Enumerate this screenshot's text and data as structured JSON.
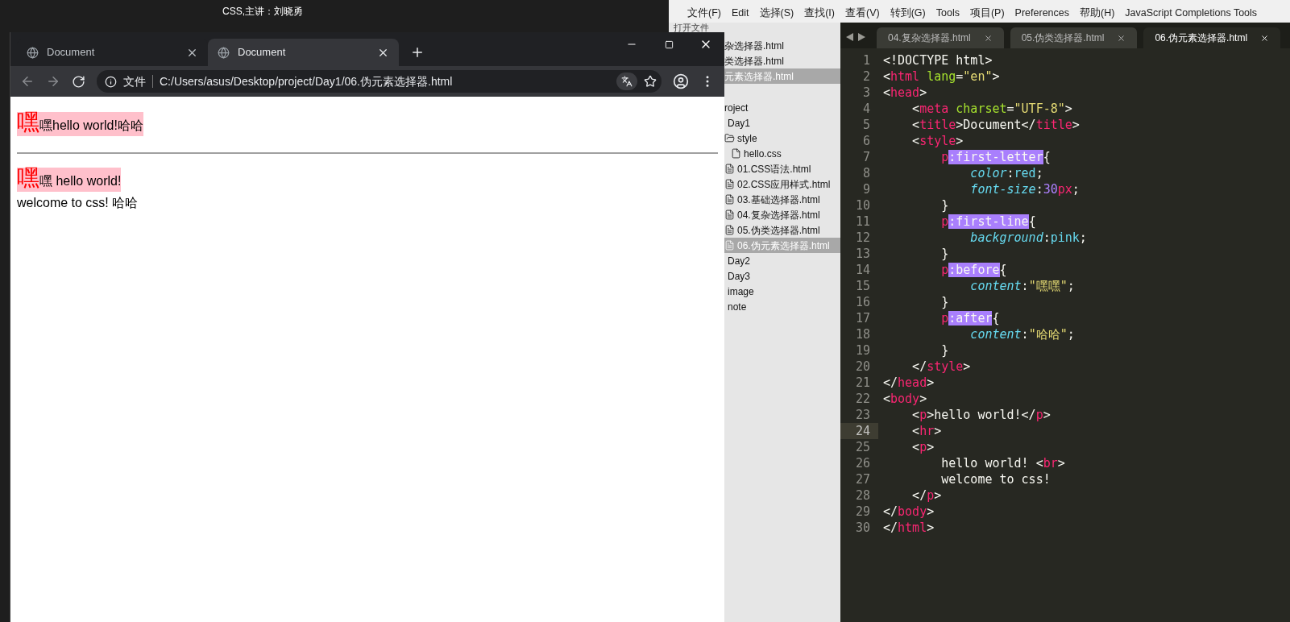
{
  "desktop": {
    "caption": "CSS,主讲：刘晓勇"
  },
  "browser": {
    "tabs": [
      {
        "title": "Document",
        "selected": false
      },
      {
        "title": "Document",
        "selected": true
      }
    ],
    "address": {
      "scheme_label": "文件",
      "url": "C:/Users/asus/Desktop/project/Day1/06.伪元素选择器.html"
    },
    "page": {
      "blocks": [
        {
          "kind": "paragraph",
          "first_letter": "嘿",
          "first_line": "嘿hello world!哈哈"
        },
        {
          "kind": "rule"
        },
        {
          "kind": "paragraph",
          "first_letter": "嘿",
          "first_line": "嘿 hello world!",
          "next_line": "welcome to css! 哈哈"
        }
      ]
    }
  },
  "editor": {
    "menu": [
      "文件(F)",
      "Edit",
      "选择(S)",
      "查找(I)",
      "查看(V)",
      "转到(G)",
      "Tools",
      "项目(P)",
      "Preferences",
      "帮助(H)",
      "JavaScript Completions Tools"
    ],
    "sidebar": {
      "header": "打开文件",
      "open_files": [
        {
          "name": "杂选择器.html",
          "selected": false
        },
        {
          "name": "类选择器.html",
          "selected": false
        },
        {
          "name": "元素选择器.html",
          "selected": true
        }
      ],
      "folders": [
        {
          "name": "roject",
          "kind": "folder",
          "selected": false,
          "children": [
            {
              "name": "Day1",
              "kind": "folder",
              "selected": false,
              "children": [
                {
                  "name": "style",
                  "kind": "open_folder",
                  "selected": false,
                  "children": [
                    {
                      "name": "hello.css",
                      "kind": "plain_file",
                      "selected": false
                    }
                  ]
                },
                {
                  "name": "01.CSS语法.html",
                  "kind": "file",
                  "selected": false
                },
                {
                  "name": "02.CSS应用样式.html",
                  "kind": "file",
                  "selected": false
                },
                {
                  "name": "03.基础选择器.html",
                  "kind": "file",
                  "selected": false
                },
                {
                  "name": "04.复杂选择器.html",
                  "kind": "file",
                  "selected": false
                },
                {
                  "name": "05.伪类选择器.html",
                  "kind": "file",
                  "selected": false
                },
                {
                  "name": "06.伪元素选择器.html",
                  "kind": "file",
                  "selected": true
                }
              ]
            },
            {
              "name": "Day2",
              "kind": "folder",
              "selected": false
            },
            {
              "name": "Day3",
              "kind": "folder",
              "selected": false
            },
            {
              "name": "image",
              "kind": "folder",
              "selected": false
            },
            {
              "name": "note",
              "kind": "folder",
              "selected": false
            }
          ]
        }
      ]
    },
    "tabs": [
      {
        "title": "04.复杂选择器.html",
        "selected": false
      },
      {
        "title": "05.伪类选择器.html",
        "selected": false
      },
      {
        "title": "06.伪元素选择器.html",
        "selected": true
      }
    ],
    "lines": [
      {
        "number": "1",
        "current": false,
        "tokens": [
          {
            "kind": "punct",
            "text": "<!DOCTYPE html>"
          }
        ]
      },
      {
        "number": "2",
        "current": false,
        "tokens": [
          {
            "kind": "punct",
            "text": "<"
          },
          {
            "kind": "tag",
            "text": "html"
          },
          {
            "kind": "attr",
            "text": " lang"
          },
          {
            "kind": "punct",
            "text": "="
          },
          {
            "kind": "string",
            "text": "\"en\""
          },
          {
            "kind": "punct",
            "text": ">"
          }
        ]
      },
      {
        "number": "3",
        "current": false,
        "tokens": [
          {
            "kind": "punct",
            "text": "<"
          },
          {
            "kind": "tag",
            "text": "head"
          },
          {
            "kind": "punct",
            "text": ">"
          }
        ]
      },
      {
        "number": "4",
        "current": false,
        "tokens": [
          {
            "kind": "punct",
            "text": "    <"
          },
          {
            "kind": "tag",
            "text": "meta"
          },
          {
            "kind": "attr",
            "text": " charset"
          },
          {
            "kind": "punct",
            "text": "="
          },
          {
            "kind": "string",
            "text": "\"UTF-8\""
          },
          {
            "kind": "punct",
            "text": ">"
          }
        ]
      },
      {
        "number": "5",
        "current": false,
        "tokens": [
          {
            "kind": "punct",
            "text": "    <"
          },
          {
            "kind": "tag",
            "text": "title"
          },
          {
            "kind": "punct",
            "text": ">Document</"
          },
          {
            "kind": "tag",
            "text": "title"
          },
          {
            "kind": "punct",
            "text": ">"
          }
        ]
      },
      {
        "number": "6",
        "current": false,
        "tokens": [
          {
            "kind": "punct",
            "text": "    <"
          },
          {
            "kind": "tag",
            "text": "style"
          },
          {
            "kind": "punct",
            "text": ">"
          }
        ]
      },
      {
        "number": "7",
        "current": false,
        "tokens": [
          {
            "kind": "tag",
            "text": "        p"
          },
          {
            "kind": "pseudo",
            "text": ":first-letter"
          },
          {
            "kind": "punct",
            "text": "{"
          }
        ]
      },
      {
        "number": "8",
        "current": false,
        "tokens": [
          {
            "kind": "property",
            "text": "            color"
          },
          {
            "kind": "punct",
            "text": ":"
          },
          {
            "kind": "value",
            "text": "red"
          },
          {
            "kind": "punct",
            "text": ";"
          }
        ]
      },
      {
        "number": "9",
        "current": false,
        "tokens": [
          {
            "kind": "property",
            "text": "            font-size"
          },
          {
            "kind": "punct",
            "text": ":"
          },
          {
            "kind": "number",
            "text": "30"
          },
          {
            "kind": "tag",
            "text": "px"
          },
          {
            "kind": "punct",
            "text": ";"
          }
        ]
      },
      {
        "number": "10",
        "current": false,
        "tokens": [
          {
            "kind": "punct",
            "text": "        }"
          }
        ]
      },
      {
        "number": "11",
        "current": false,
        "tokens": [
          {
            "kind": "tag",
            "text": "        p"
          },
          {
            "kind": "pseudo",
            "text": ":first-line"
          },
          {
            "kind": "punct",
            "text": "{"
          }
        ]
      },
      {
        "number": "12",
        "current": false,
        "tokens": [
          {
            "kind": "property",
            "text": "            background"
          },
          {
            "kind": "punct",
            "text": ":"
          },
          {
            "kind": "value",
            "text": "pink"
          },
          {
            "kind": "punct",
            "text": ";"
          }
        ]
      },
      {
        "number": "13",
        "current": false,
        "tokens": [
          {
            "kind": "punct",
            "text": "        }"
          }
        ]
      },
      {
        "number": "14",
        "current": false,
        "tokens": [
          {
            "kind": "tag",
            "text": "        p"
          },
          {
            "kind": "pseudo",
            "text": ":before"
          },
          {
            "kind": "punct",
            "text": "{"
          }
        ]
      },
      {
        "number": "15",
        "current": false,
        "tokens": [
          {
            "kind": "property",
            "text": "            content"
          },
          {
            "kind": "punct",
            "text": ":"
          },
          {
            "kind": "string",
            "text": "\"嘿嘿\""
          },
          {
            "kind": "punct",
            "text": ";"
          }
        ]
      },
      {
        "number": "16",
        "current": false,
        "tokens": [
          {
            "kind": "punct",
            "text": "        }"
          }
        ]
      },
      {
        "number": "17",
        "current": false,
        "tokens": [
          {
            "kind": "tag",
            "text": "        p"
          },
          {
            "kind": "pseudo",
            "text": ":after"
          },
          {
            "kind": "punct",
            "text": "{"
          }
        ]
      },
      {
        "number": "18",
        "current": false,
        "tokens": [
          {
            "kind": "property",
            "text": "            content"
          },
          {
            "kind": "punct",
            "text": ":"
          },
          {
            "kind": "string",
            "text": "\"哈哈\""
          },
          {
            "kind": "punct",
            "text": ";"
          }
        ]
      },
      {
        "number": "19",
        "current": false,
        "tokens": [
          {
            "kind": "punct",
            "text": "        }"
          }
        ]
      },
      {
        "number": "20",
        "current": false,
        "tokens": [
          {
            "kind": "punct",
            "text": "    </"
          },
          {
            "kind": "tag",
            "text": "style"
          },
          {
            "kind": "punct",
            "text": ">"
          }
        ]
      },
      {
        "number": "21",
        "current": false,
        "tokens": [
          {
            "kind": "punct",
            "text": "</"
          },
          {
            "kind": "tag",
            "text": "head"
          },
          {
            "kind": "punct",
            "text": ">"
          }
        ]
      },
      {
        "number": "22",
        "current": false,
        "tokens": [
          {
            "kind": "punct",
            "text": "<"
          },
          {
            "kind": "tag",
            "text": "body"
          },
          {
            "kind": "punct",
            "text": ">"
          }
        ]
      },
      {
        "number": "23",
        "current": false,
        "tokens": [
          {
            "kind": "punct",
            "text": "    <"
          },
          {
            "kind": "tag",
            "text": "p"
          },
          {
            "kind": "punct",
            "text": ">hello world!</"
          },
          {
            "kind": "tag",
            "text": "p"
          },
          {
            "kind": "punct",
            "text": ">"
          }
        ]
      },
      {
        "number": "24",
        "current": true,
        "tokens": [
          {
            "kind": "punct",
            "text": "    <"
          },
          {
            "kind": "tag",
            "text": "hr"
          },
          {
            "kind": "punct",
            "text": ">"
          }
        ]
      },
      {
        "number": "25",
        "current": false,
        "tokens": [
          {
            "kind": "punct",
            "text": "    <"
          },
          {
            "kind": "tag",
            "text": "p"
          },
          {
            "kind": "punct",
            "text": ">"
          }
        ]
      },
      {
        "number": "26",
        "current": false,
        "tokens": [
          {
            "kind": "punct",
            "text": "        hello world! <"
          },
          {
            "kind": "tag",
            "text": "br"
          },
          {
            "kind": "punct",
            "text": ">"
          }
        ]
      },
      {
        "number": "27",
        "current": false,
        "tokens": [
          {
            "kind": "punct",
            "text": "        welcome to css!"
          }
        ]
      },
      {
        "number": "28",
        "current": false,
        "tokens": [
          {
            "kind": "punct",
            "text": "    </"
          },
          {
            "kind": "tag",
            "text": "p"
          },
          {
            "kind": "punct",
            "text": ">"
          }
        ]
      },
      {
        "number": "29",
        "current": false,
        "tokens": [
          {
            "kind": "punct",
            "text": "</"
          },
          {
            "kind": "tag",
            "text": "body"
          },
          {
            "kind": "punct",
            "text": ">"
          }
        ]
      },
      {
        "number": "30",
        "current": false,
        "tokens": [
          {
            "kind": "punct",
            "text": "</"
          },
          {
            "kind": "tag",
            "text": "html"
          },
          {
            "kind": "punct",
            "text": ">"
          }
        ]
      }
    ]
  }
}
